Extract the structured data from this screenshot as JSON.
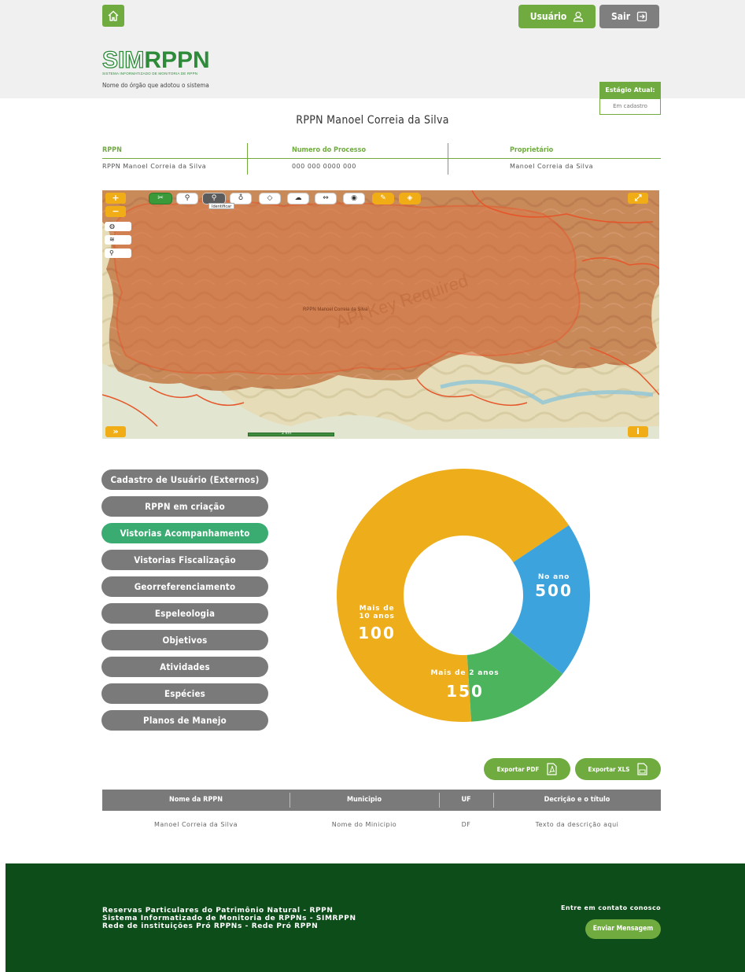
{
  "header": {
    "user_label": "Usuário",
    "exit_label": "Sair",
    "logo_sim": "SIM",
    "logo_rppn": "RPPN",
    "logo_subtitle": "SISTEMA INFORMATIZADO DE MONITORIA DE RPPN",
    "org_name": "Nome do órgão que adotou o sistema",
    "stage_label": "Estágio Atual:",
    "stage_value": "Em cadastro"
  },
  "page_title": "RPPN Manoel Correia da Silva",
  "info": {
    "rppn_label": "RPPN",
    "rppn_value": "RPPN Manoel Correia da Silva",
    "process_label": "Numero do Processo",
    "process_value": "000 000 0000 000",
    "owner_label": "Proprietário",
    "owner_value": "Manoel Correia da Silva"
  },
  "map": {
    "zoom_in": "+",
    "zoom_out": "−",
    "expand": "⤢",
    "forward": "»",
    "tooltip": "Identificar",
    "watermark": "API Key Required",
    "area_label": "RPPN Manoel Correia da Silva",
    "scale": "2 km"
  },
  "menu": [
    {
      "label": "Cadastro de Usuário (Externos)",
      "active": false
    },
    {
      "label": "RPPN em criação",
      "active": false
    },
    {
      "label": "Vistorias Acompanhamento",
      "active": true
    },
    {
      "label": "Vistorias Fiscalização",
      "active": false
    },
    {
      "label": "Georreferenciamento",
      "active": false
    },
    {
      "label": "Espeleologia",
      "active": false
    },
    {
      "label": "Objetivos",
      "active": false
    },
    {
      "label": "Atividades",
      "active": false
    },
    {
      "label": "Espécies",
      "active": false
    },
    {
      "label": "Planos de Manejo",
      "active": false
    }
  ],
  "chart_data": {
    "type": "pie",
    "variant": "donut",
    "title": "",
    "series": [
      {
        "name": "No ano",
        "value": 500,
        "color": "#eeae1c"
      },
      {
        "name": "Mais de 2 anos",
        "value": 150,
        "color": "#3ca3dc"
      },
      {
        "name": "Mais de 10 anos",
        "value": 100,
        "color": "#4db45e"
      }
    ],
    "labels": {
      "ano_small": "No ano",
      "ano_big": "500",
      "dois_small": "Mais de 2 anos",
      "dois_big": "150",
      "dez_small_1": "Mais de",
      "dez_small_2": "10 anos",
      "dez_big": "100"
    }
  },
  "export": {
    "pdf_label": "Exportar PDF",
    "xls_label": "Exportar XLS"
  },
  "table": {
    "headers": [
      "Nome da RPPN",
      "Municipio",
      "UF",
      "Decrição e o título"
    ],
    "rows": [
      [
        "Manoel Correia da Silva",
        "Nome do Minicipio",
        "DF",
        "Texto da descrição aqui"
      ]
    ]
  },
  "footer": {
    "line1": "Reservas Particulares do Patrimônio Natural - RPPN",
    "line2": "Sistema Informatizado de Monitoria de RPPNs - SIMRPPN",
    "line3": "Rede de instituições Pró RPPNs - Rede Pró RPPN",
    "contact": "Entre em contato conosco",
    "send_label": "Enviar Mensagem"
  },
  "colors": {
    "brand_green": "#6fab3f",
    "dark_green": "#0d4d1a",
    "active_teal": "#3aac72",
    "gray_button": "#7a7a7a",
    "map_polygon": "#e86a2c"
  }
}
